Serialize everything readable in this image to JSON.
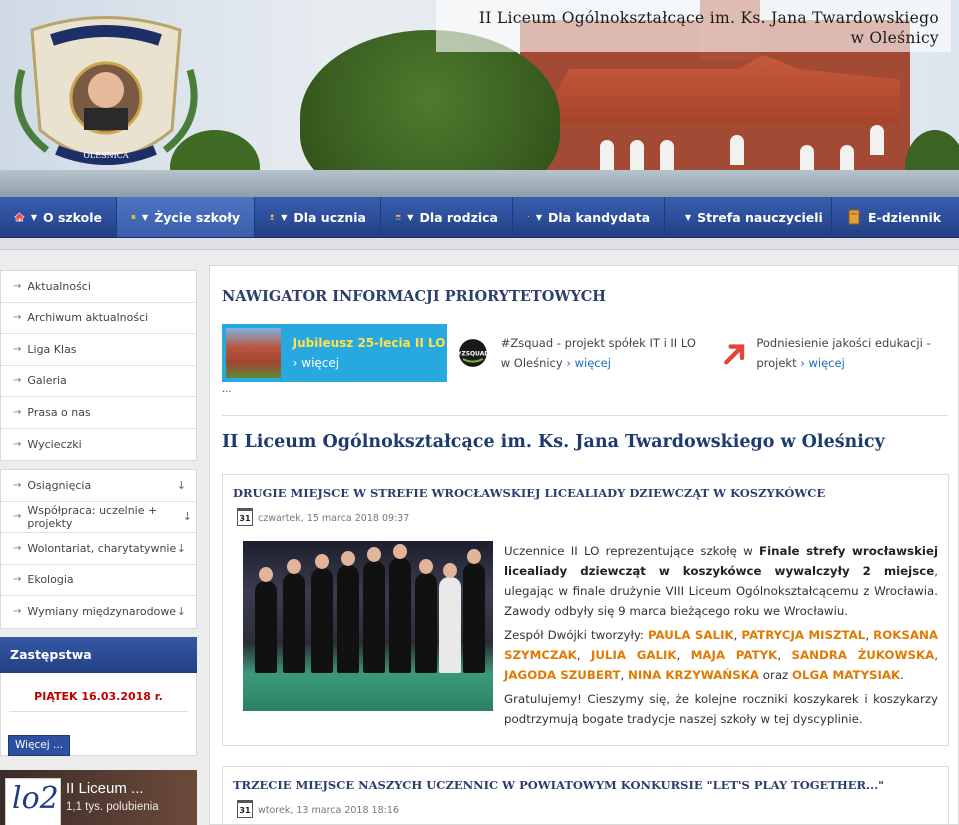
{
  "header": {
    "title_line1": "II Liceum Ogólnokształcące im. Ks. Jana Twardowskiego",
    "title_line2": "w Oleśnicy"
  },
  "nav": {
    "items": [
      {
        "label": "O szkole",
        "icon": "home-icon"
      },
      {
        "label": "Życie szkoły",
        "icon": "notebook-icon"
      },
      {
        "label": "Dla ucznia",
        "icon": "student-icon"
      },
      {
        "label": "Dla rodzica",
        "icon": "parents-icon"
      },
      {
        "label": "Dla kandydata",
        "icon": "candidate-icon"
      },
      {
        "label": "Strefa nauczycieli",
        "icon": "teacher-icon"
      },
      {
        "label": "E-dziennik",
        "icon": "journal-icon"
      }
    ]
  },
  "sidebar": {
    "menu1": [
      "Aktualności",
      "Archiwum aktualności",
      "Liga Klas",
      "Galeria",
      "Prasa o nas",
      "Wycieczki"
    ],
    "menu2": [
      "Osiągnięcia",
      "Współpraca: uczelnie + projekty",
      "Wolontariat, charytatywnie",
      "Ekologia",
      "Wymiany międzynarodowe"
    ],
    "zastepstwa": {
      "title": "Zastępstwa",
      "date": "PIĄTEK 16.03.2018 r.",
      "more": "Więcej ..."
    },
    "facebook": {
      "logo": "lo2",
      "name": "II Liceum ...",
      "likes": "1,1 tys. polubienia"
    }
  },
  "main": {
    "navigator_title": "NAWIGATOR INFORMACJI PRIORYTETOWYCH",
    "priority": [
      {
        "text": "Jubileusz 25-lecia II LO",
        "more": "› więcej"
      },
      {
        "text": "#Zsquad - projekt spółek IT i II LO w Oleśnicy",
        "more": "› więcej"
      },
      {
        "text": "Podniesienie jakości edukacji - projekt",
        "more": "› więcej"
      }
    ],
    "dots": "...",
    "school_title": "II Liceum Ogólnokształcące im. Ks. Jana Twardowskiego w Oleśnicy",
    "articles": [
      {
        "title": "DRUGIE MIEJSCE W STREFIE WROCŁAWSKIEJ LICEALIADY DZIEWCZĄT W KOSZYKÓWCE",
        "date": "czwartek, 15 marca 2018 09:37",
        "cal": "31",
        "p1_a": "Uczennice II LO reprezentujące szkołę w ",
        "p1_b": "Finale strefy wrocławskiej licealiady dziewcząt w koszykówce wywalczyły 2 miejsce",
        "p1_c": ", ulegając w finale drużynie VIII Liceum Ogólnokształcącemu z Wrocławia. Zawody odbyły się 9 marca bieżącego roku we Wrocławiu.",
        "p2_lead": "Zespół Dwójki tworzyły: ",
        "players": [
          "PAULA SALIK",
          "PATRYCJA MISZTAL",
          "ROKSANA SZYMCZAK",
          "JULIA GALIK",
          "MAJA PATYK",
          "SANDRA ŻUKOWSKA",
          "JAGODA SZUBERT",
          "NINA KRZYWAŃSKA"
        ],
        "p2_and": " oraz ",
        "last_player": "OLGA MATYSIAK",
        "p3": "Gratulujemy! Cieszymy się, że kolejne roczniki koszykarek i koszykarzy podtrzymują bogate tradycje naszej szkoły w tej dyscyplinie."
      },
      {
        "title": "TRZECIE MIEJSCE NASZYCH UCZENNIC W POWIATOWYM KONKURSIE \"LET'S PLAY TOGETHER...\"",
        "date": "wtorek, 13 marca 2018 18:16",
        "cal": "31"
      }
    ]
  },
  "colors": {
    "nav_blue": "#2d4f9c",
    "accent_orange": "#e07a00",
    "red": "#c00000",
    "prio_blue": "#27a8df"
  }
}
